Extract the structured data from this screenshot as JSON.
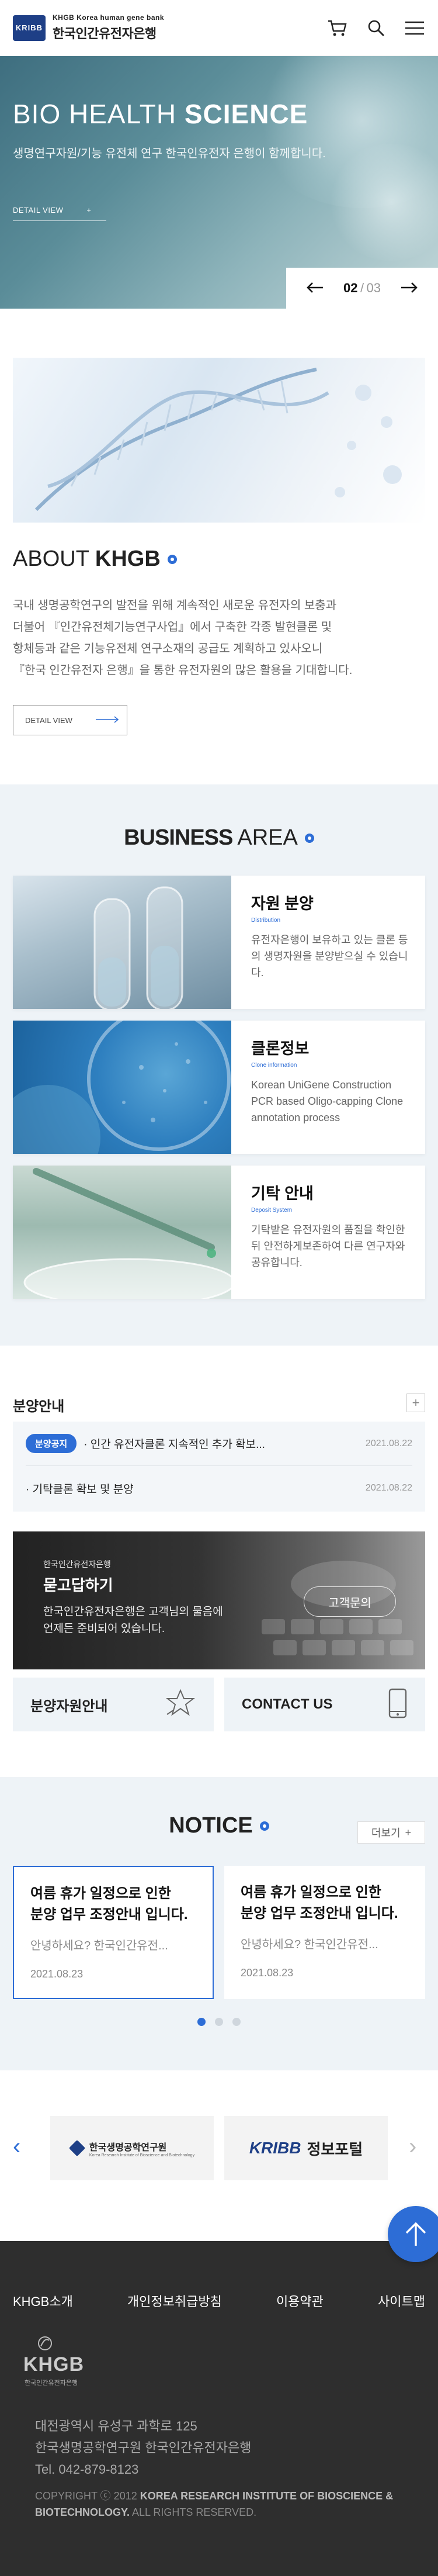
{
  "header": {
    "logo_mark": "KRIBB",
    "logo_en": "KHGB Korea human gene bank",
    "logo_ko": "한국인간유전자은행"
  },
  "hero": {
    "title_light": "BIO HEALTH ",
    "title_bold": "SCIENCE",
    "subtitle": "생명연구자원/기능 유전체 연구 한국인유전자 은행이 함께합니다.",
    "detail_label": "DETAIL VIEW",
    "page_current": "02",
    "page_sep": "/",
    "page_total": "03"
  },
  "about": {
    "title_light": "ABOUT",
    "title_bold": "KHGB",
    "desc_lines": [
      "국내 생명공학연구의 발전을 위해 계속적인 새로운 유전자의 보충과",
      "더불어 『인간유전체기능연구사업』에서 구축한 각종 발현클론 및",
      "항체등과 같은 기능유전체 연구소재의 공급도 계획하고 있사오니",
      "『한국 인간유전자 은행』을 통한 유전자원의 많은 활용을 기대합니다."
    ],
    "detail_label": "DETAIL VIEW"
  },
  "business": {
    "title_bold": "BUSINESS",
    "title_light": "AREA",
    "cards": [
      {
        "name": "자원 분양",
        "en": "Distribution",
        "text": "유전자은행이 보유하고 있는 클론 등의 생명자원을 분양받으실 수 있습니다."
      },
      {
        "name": "클론정보",
        "en": "Clone information",
        "text": "Korean UniGene Construction PCR based Oligo-capping Clone annotation process"
      },
      {
        "name": "기탁 안내",
        "en": "Deposit System",
        "text": "기탁받은 유전자원의 품질을 확인한뒤 안전하게보존하여 다른 연구자와 공유합니다."
      }
    ]
  },
  "distribution": {
    "title": "분양안내",
    "items": [
      {
        "badge": "분양공지",
        "text": "· 인간 유전자클론 지속적인 추가 확보...",
        "date": "2021.08.22"
      },
      {
        "badge": "",
        "text": "· 기탁클론 확보 및 분양",
        "date": "2021.08.22"
      }
    ]
  },
  "qna": {
    "small": "한국인간유전자은행",
    "title": "묻고답하기",
    "desc_lines": [
      "한국인간유전자은행은 고객님의 물음에",
      "언제든 준비되어 있습니다."
    ],
    "button": "고객문의"
  },
  "quick_links": {
    "left": "분양자원안내",
    "right": "CONTACT US"
  },
  "notice": {
    "title": "NOTICE",
    "more": "더보기",
    "cards": [
      {
        "title_lines": [
          "여름 휴가 일정으로 인한",
          "분양 업무 조정안내 입니다."
        ],
        "desc": "안녕하세요? 한국인간유전...",
        "date": "2021.08.23"
      },
      {
        "title_lines": [
          "여름 휴가 일정으로 인한",
          "분양 업무 조정안내 입니다."
        ],
        "desc": "안녕하세요? 한국인간유전...",
        "date": "2021.08.23"
      }
    ]
  },
  "partners": [
    {
      "name": "한국생명공학연구원",
      "sub": "Korea Research Institute of Bioscience and Biotechnology"
    },
    {
      "name": "정보포털",
      "sub": "KRIBB"
    }
  ],
  "footer": {
    "links": [
      "KHGB소개",
      "개인정보취급방침",
      "이용약관",
      "사이트맵"
    ],
    "logo_text": "KHGB",
    "logo_sub": "한국인간유전자은행",
    "address_lines": [
      "대전광역시 유성구 과학로 125",
      "한국생명공학연구원 한국인간유전자은행",
      "Tel. 042-879-8123"
    ],
    "copyright_prefix": "COPYRIGHT ⓒ 2012 ",
    "copyright_bold": "KOREA RESEARCH INSTITUTE OF BIOSCIENCE & BIOTECHNOLOGY.",
    "copyright_suffix": " ALL RIGHTS RESERVED."
  },
  "colors": {
    "accent": "#2d6dd6",
    "brand_navy": "#1e3f86",
    "footer_bg": "#2e2e2e",
    "section_bg": "#eef3f7"
  }
}
